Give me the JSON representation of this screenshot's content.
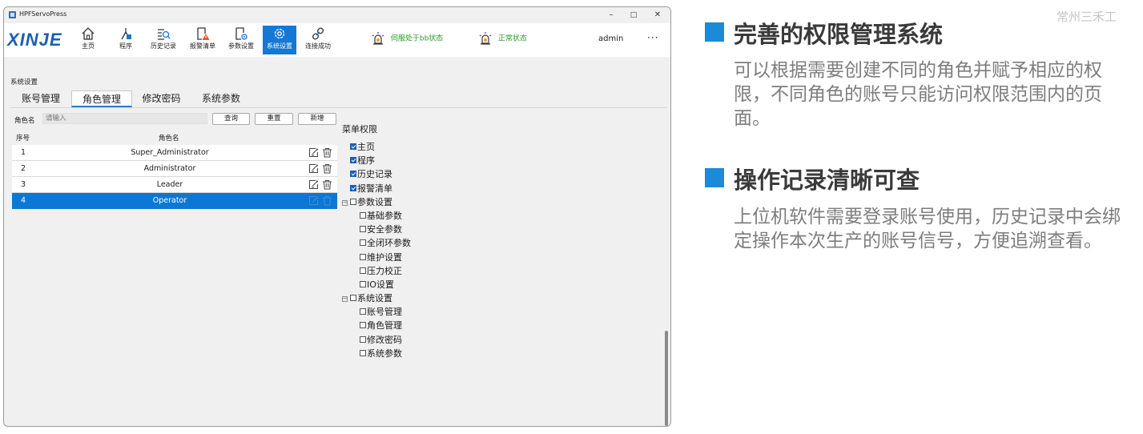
{
  "window": {
    "title": "HPFServoPress",
    "controls": {
      "minimize": "–",
      "maximize": "□",
      "close": "✕"
    }
  },
  "toolbar": {
    "logo": "XINJE",
    "buttons": [
      {
        "label": "主页",
        "icon": "home-icon"
      },
      {
        "label": "程序",
        "icon": "program-icon"
      },
      {
        "label": "历史记录",
        "icon": "history-icon"
      },
      {
        "label": "报警清单",
        "icon": "alarm-list-icon"
      },
      {
        "label": "参数设置",
        "icon": "parameter-icon"
      },
      {
        "label": "系统设置",
        "icon": "gear-icon",
        "active": true
      },
      {
        "label": "连接成功",
        "icon": "link-icon"
      }
    ],
    "status": [
      {
        "text": "伺服处于bb状态",
        "icon": "servo-beacon-icon"
      },
      {
        "text": "正常状态",
        "icon": "normal-beacon-icon"
      }
    ],
    "user": "admin",
    "more": "···"
  },
  "breadcrumb": "系统设置",
  "tabs": [
    {
      "label": "账号管理"
    },
    {
      "label": "角色管理",
      "active": true
    },
    {
      "label": "修改密码"
    },
    {
      "label": "系统参数"
    }
  ],
  "role_filter": {
    "label": "角色名",
    "placeholder": "请输入",
    "query": "查询",
    "reset": "重置",
    "add": "新增"
  },
  "table": {
    "headers": {
      "no": "序号",
      "name": "角色名"
    },
    "rows": [
      {
        "no": "1",
        "name": "Super_Administrator"
      },
      {
        "no": "2",
        "name": "Administrator"
      },
      {
        "no": "3",
        "name": "Leader"
      },
      {
        "no": "4",
        "name": "Operator",
        "selected": true
      }
    ]
  },
  "permissions": {
    "title": "菜单权限",
    "items": [
      {
        "label": "主页",
        "checked": true
      },
      {
        "label": "程序",
        "checked": true
      },
      {
        "label": "历史记录",
        "checked": true
      },
      {
        "label": "报警清单",
        "checked": true
      },
      {
        "label": "参数设置",
        "checked": false,
        "group": true
      },
      {
        "label": "基础参数",
        "checked": false
      },
      {
        "label": "安全参数",
        "checked": false
      },
      {
        "label": "全闭环参数",
        "checked": false
      },
      {
        "label": "维护设置",
        "checked": false
      },
      {
        "label": "压力校正",
        "checked": false
      },
      {
        "label": "IO设置",
        "checked": false
      },
      {
        "label": "系统设置",
        "checked": false,
        "group": true
      },
      {
        "label": "账号管理",
        "checked": false
      },
      {
        "label": "角色管理",
        "checked": false
      },
      {
        "label": "修改密码",
        "checked": false
      },
      {
        "label": "系统参数",
        "checked": false
      }
    ]
  },
  "right": {
    "watermark": "常州三禾工",
    "sections": [
      {
        "heading": "完善的权限管理系统",
        "body": "可以根据需要创建不同的角色并赋予相应的权限，不同角色的账号只能访问权限范围内的页面。"
      },
      {
        "heading": "操作记录清晰可查",
        "body": "上位机软件需要登录账号使用，历史记录中会绑定操作本次生产的账号信号，方便追溯查看。"
      }
    ]
  },
  "colors": {
    "accent": "#1478d4",
    "selected_row": "#0c78d3",
    "status_green": "#2a9d2a",
    "heading_square": "#1c8ad6",
    "logo": "#1a5fb4"
  }
}
